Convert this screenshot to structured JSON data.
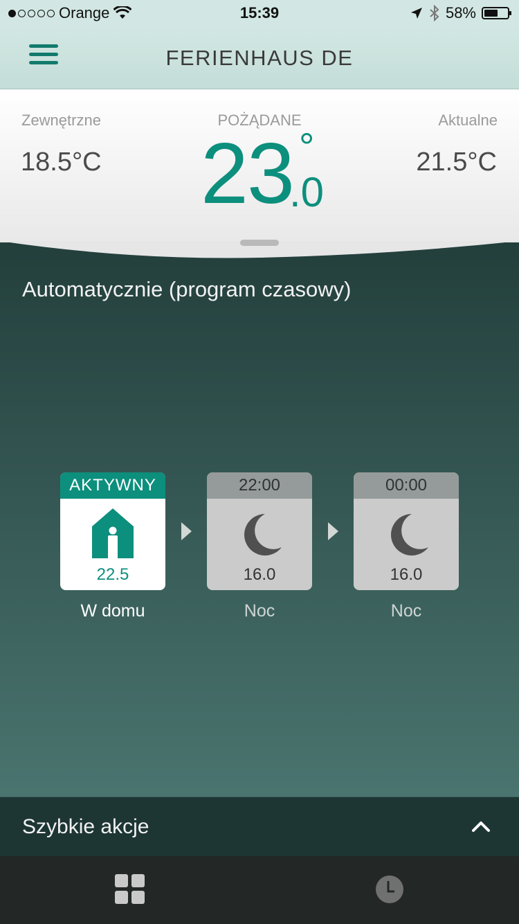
{
  "status_bar": {
    "carrier": "Orange",
    "time": "15:39",
    "battery": "58%",
    "battery_level": 0.58,
    "signal_dots_filled": 1,
    "icons": [
      "wifi-icon",
      "location-arrow-icon",
      "bluetooth-icon",
      "battery-icon"
    ]
  },
  "header": {
    "title": "FERIENHAUS DE",
    "menu_icon": "hamburger-menu-icon"
  },
  "temperatures": {
    "outside_label": "Zewnętrzne",
    "outside_value": "18.5°C",
    "desired_label": "POŻĄDANE",
    "desired_int": "23",
    "desired_deg": "°",
    "desired_dec": ".0",
    "current_label": "Aktualne",
    "current_value": "21.5°C"
  },
  "program": {
    "title": "Automatycznie (program czasowy)",
    "tiles": [
      {
        "header": "AKTYWNY",
        "value": "22.5",
        "label": "W domu",
        "icon": "home-person-icon"
      },
      {
        "header": "22:00",
        "value": "16.0",
        "label": "Noc",
        "icon": "moon-icon"
      },
      {
        "header": "00:00",
        "value": "16.0",
        "label": "Noc",
        "icon": "moon-icon"
      }
    ]
  },
  "quick_actions": {
    "label": "Szybkie akcje",
    "icon": "chevron-up-icon"
  },
  "tab_bar": {
    "tabs": [
      {
        "icon": "grid-icon"
      },
      {
        "icon": "clock-icon"
      }
    ]
  },
  "colors": {
    "accent": "#0d8f7d",
    "header_bg": "#d2e7e3",
    "panel_dark": "#233f3c",
    "tab_bar_bg": "#232827"
  }
}
